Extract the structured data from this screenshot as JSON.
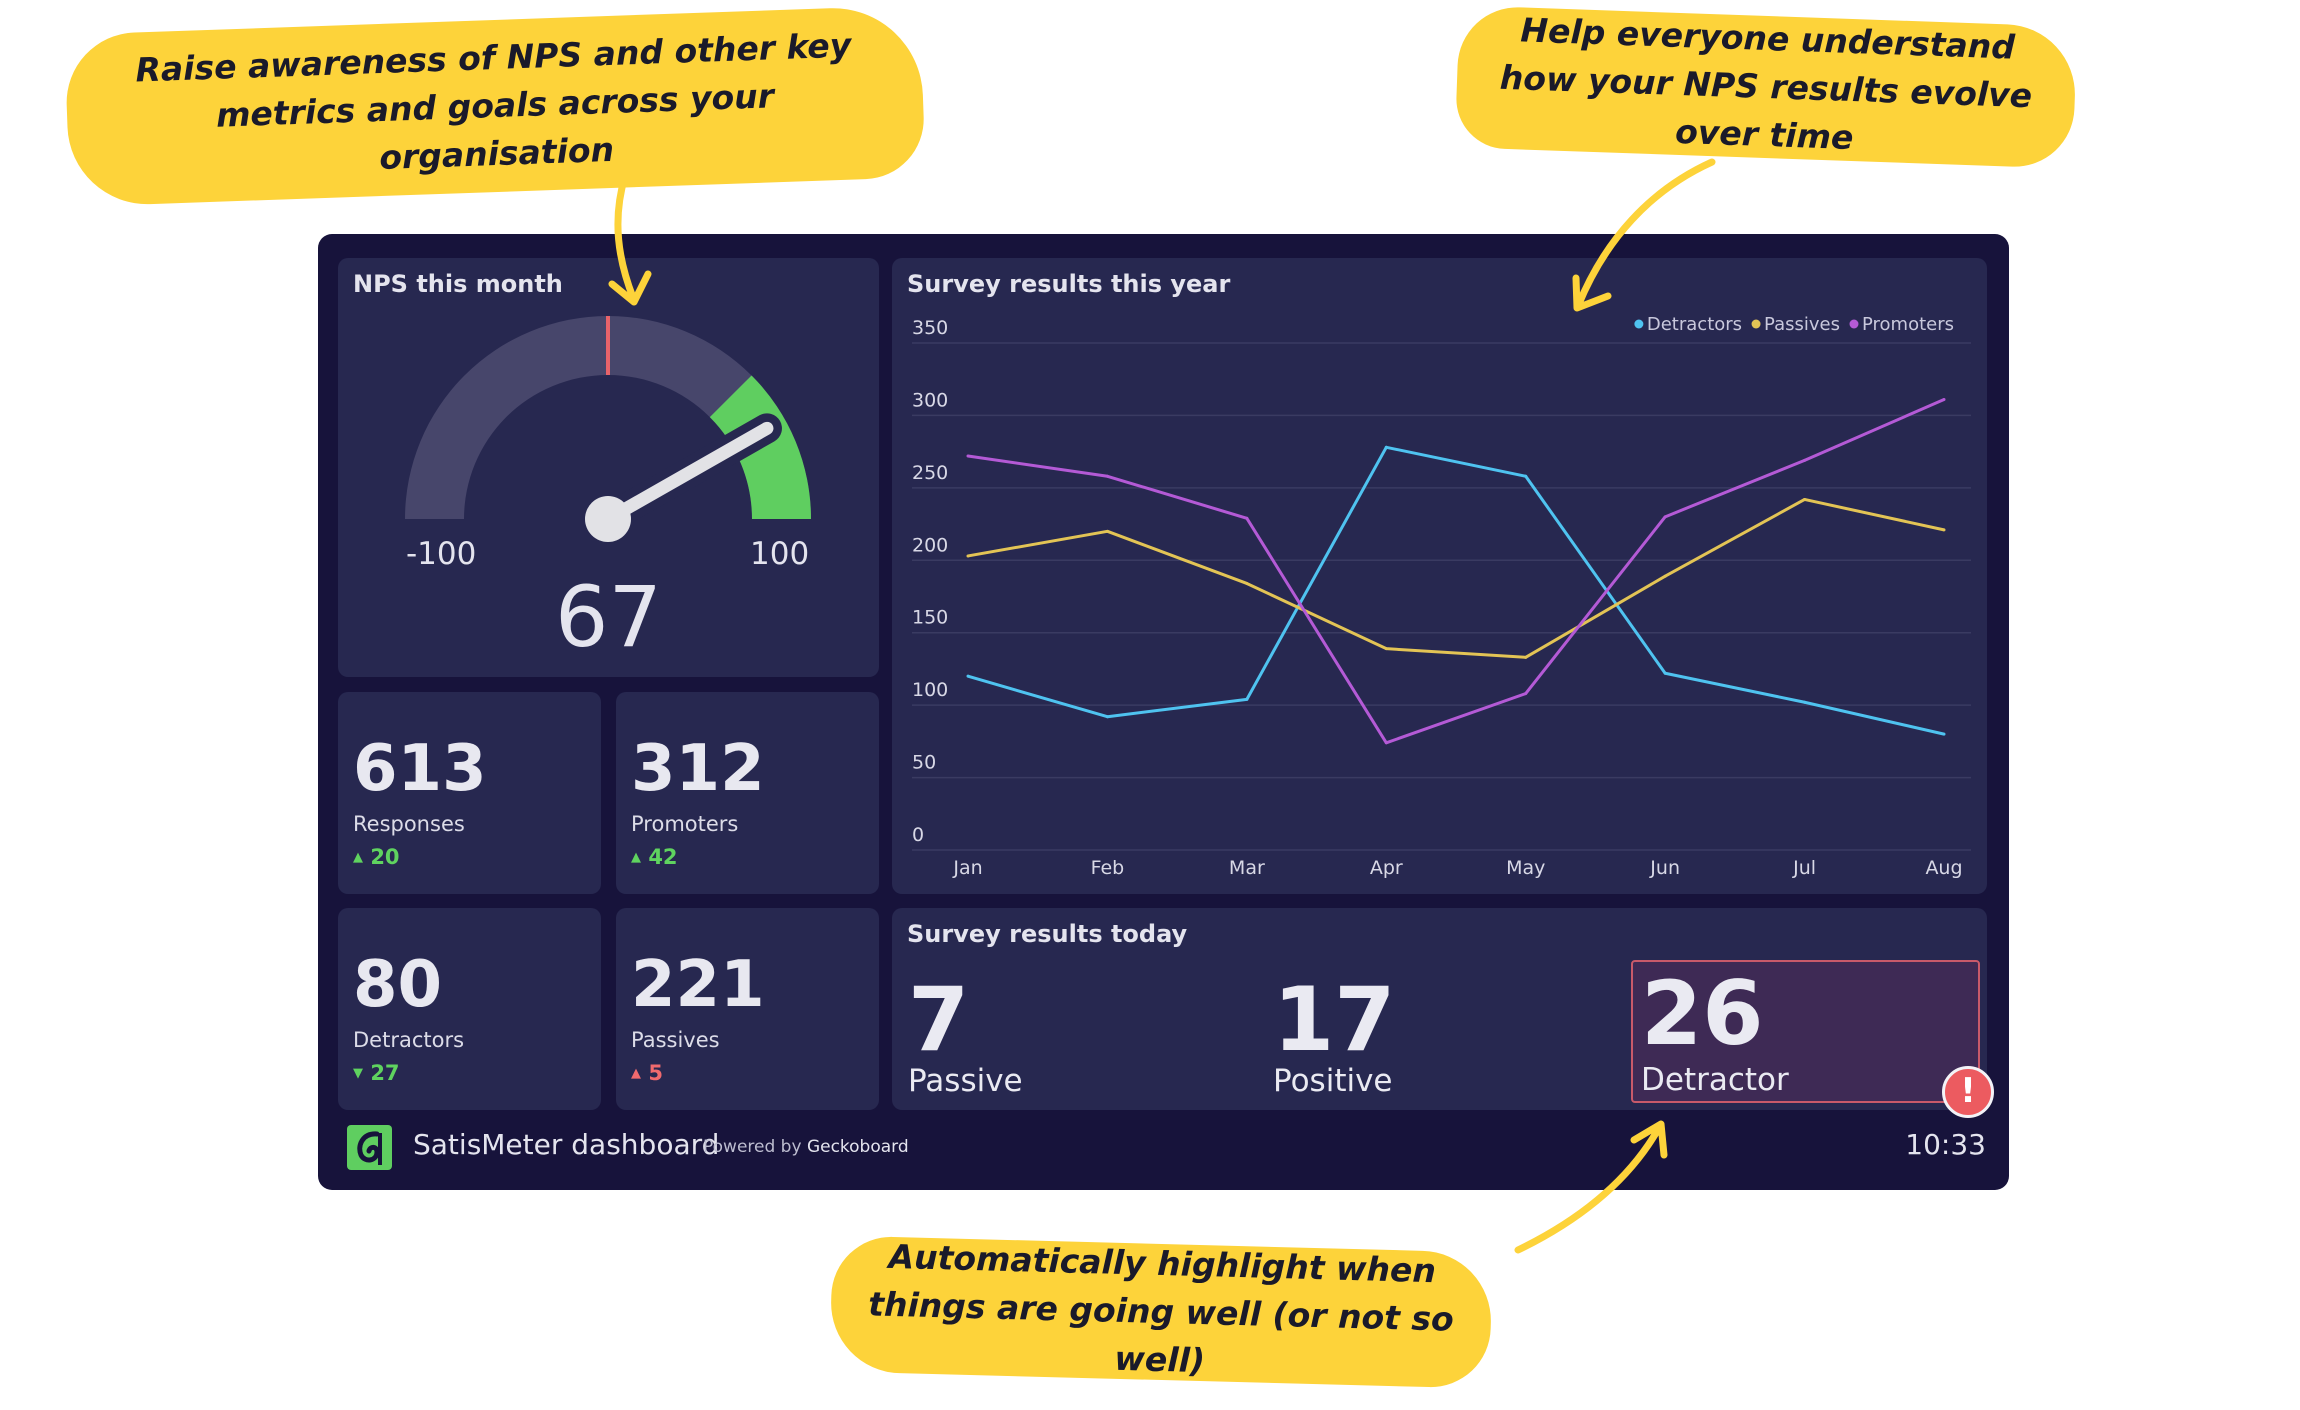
{
  "annotations": [
    {
      "text": "Raise awareness of NPS and other key metrics and goals across your organisation"
    },
    {
      "text": "Help everyone understand how your NPS results evolve over time"
    },
    {
      "text": "Automatically highlight when things are going well (or not so well)"
    }
  ],
  "gauge": {
    "title": "NPS this month",
    "min_label": "-100",
    "max_label": "100",
    "value": 67,
    "value_label": "67",
    "min": -100,
    "max": 100,
    "target": 0,
    "good_from": 50,
    "colors": {
      "track": "#47466b",
      "good": "#5fce60",
      "target": "#e8636a",
      "needle": "#e2e2e6"
    }
  },
  "stats": [
    {
      "value": "613",
      "label": "Responses",
      "delta": "20",
      "direction": "up",
      "tone": "good"
    },
    {
      "value": "312",
      "label": "Promoters",
      "delta": "42",
      "direction": "up",
      "tone": "good"
    },
    {
      "value": "80",
      "label": "Detractors",
      "delta": "27",
      "direction": "down",
      "tone": "good"
    },
    {
      "value": "221",
      "label": "Passives",
      "delta": "5",
      "direction": "up",
      "tone": "bad"
    }
  ],
  "chart_data": {
    "type": "line",
    "title": "Survey results this year",
    "categories": [
      "Jan",
      "Feb",
      "Mar",
      "Apr",
      "May",
      "Jun",
      "Jul",
      "Aug"
    ],
    "ylim": [
      0,
      350
    ],
    "yticks": [
      "0",
      "50",
      "100",
      "150",
      "200",
      "250",
      "300",
      "350"
    ],
    "grid": true,
    "legend": "top-right",
    "series": [
      {
        "name": "Detractors",
        "color": "#4fc3f0",
        "values": [
          120,
          92,
          104,
          278,
          258,
          122,
          102,
          80
        ]
      },
      {
        "name": "Passives",
        "color": "#e3c455",
        "values": [
          203,
          220,
          184,
          139,
          133,
          189,
          242,
          221
        ]
      },
      {
        "name": "Promoters",
        "color": "#b45ad6",
        "values": [
          272,
          258,
          229,
          74,
          108,
          230,
          269,
          311
        ]
      }
    ]
  },
  "today": {
    "title": "Survey results today",
    "items": [
      {
        "value": "7",
        "label": "Passive"
      },
      {
        "value": "17",
        "label": "Positive"
      },
      {
        "value": "26",
        "label": "Detractor",
        "highlight": true,
        "alert_icon": "exclamation-icon"
      }
    ]
  },
  "footer": {
    "title": "SatisMeter dashboard",
    "powered_prefix": "Powered by",
    "powered_brand": "Geckoboard",
    "time": "10:33",
    "logo_color": "#5fce60"
  }
}
